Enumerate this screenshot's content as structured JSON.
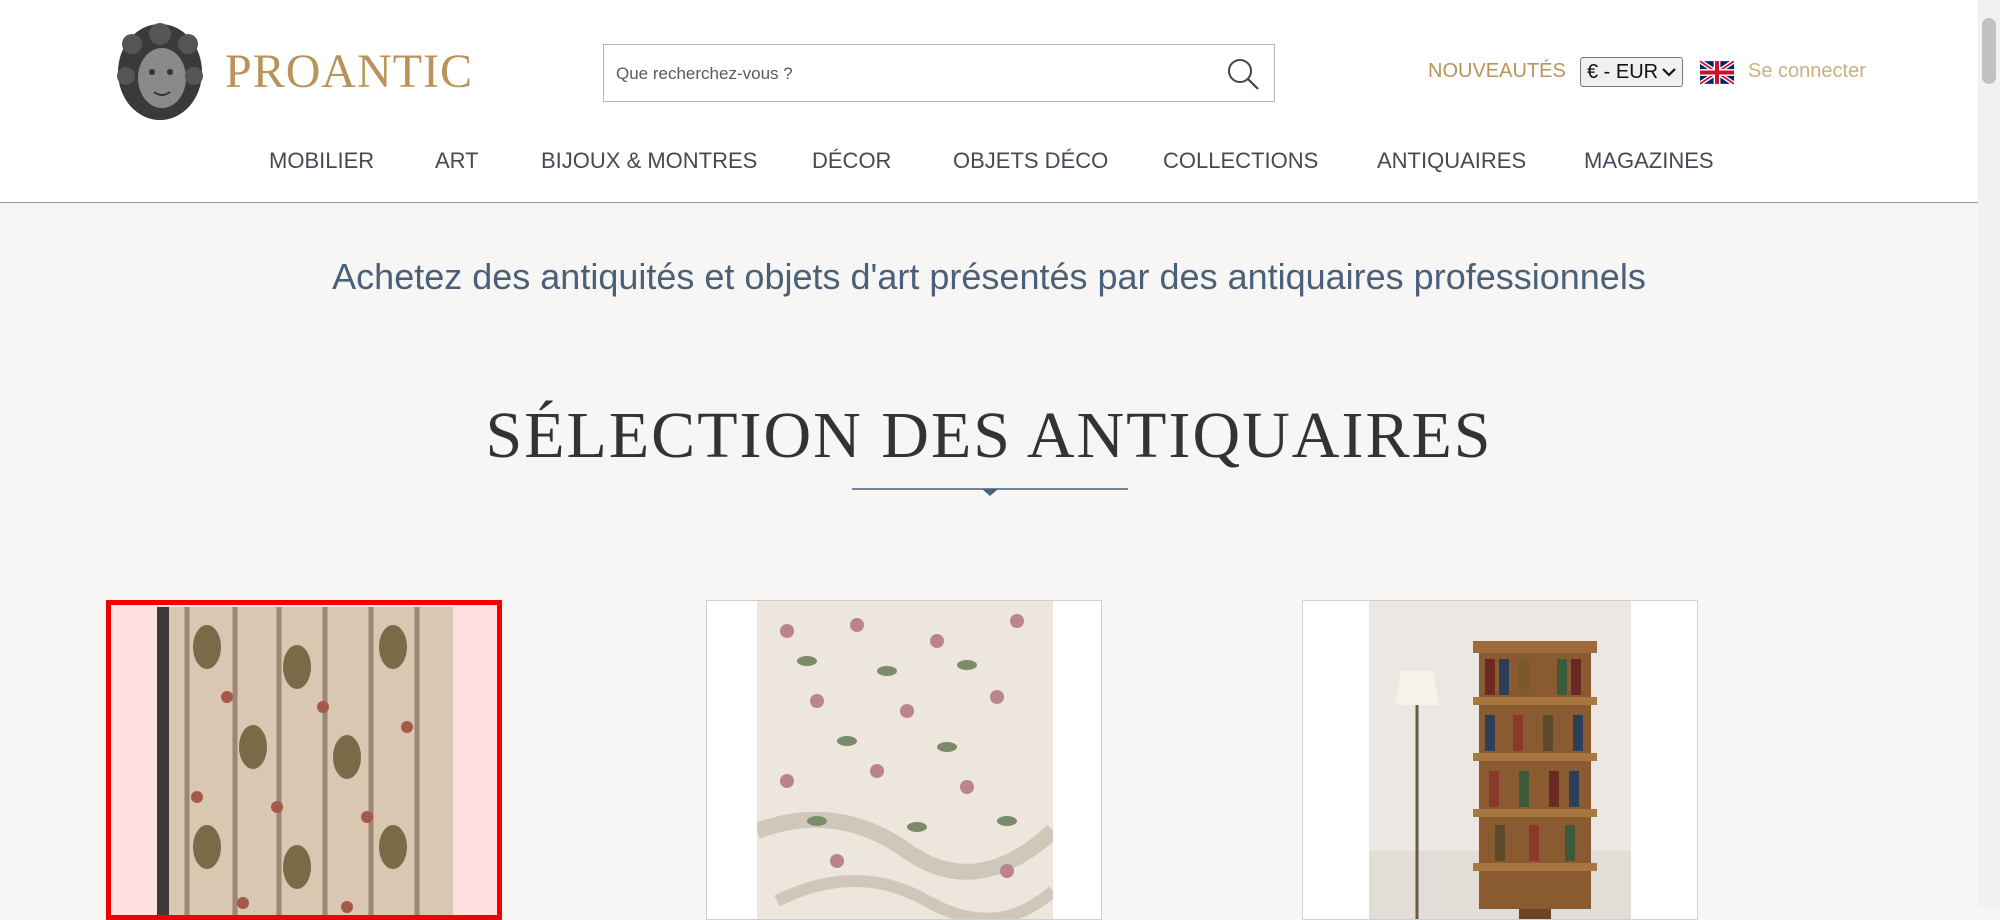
{
  "header": {
    "logo_text": "PROANTIC",
    "search": {
      "placeholder": "Que recherchez-vous ?"
    },
    "nouveautes": "NOUVEAUTÉS",
    "currency": "€ - EUR",
    "language_flag": "uk-flag-icon",
    "login": "Se connecter"
  },
  "nav": {
    "items": [
      "MOBILIER",
      "ART",
      "BIJOUX & MONTRES",
      "DÉCOR",
      "OBJETS DÉCO",
      "COLLECTIONS",
      "ANTIQUAIRES",
      "MAGAZINES"
    ]
  },
  "main": {
    "tagline": "Achetez des antiquités et objets d'art présentés par des antiquaires professionnels",
    "section_title": "SÉLECTION DES ANTIQUAIRES"
  },
  "colors": {
    "gold": "#b9935a",
    "nav_text": "#444a55",
    "tagline": "#4a607a",
    "highlight_border": "#f00000"
  }
}
